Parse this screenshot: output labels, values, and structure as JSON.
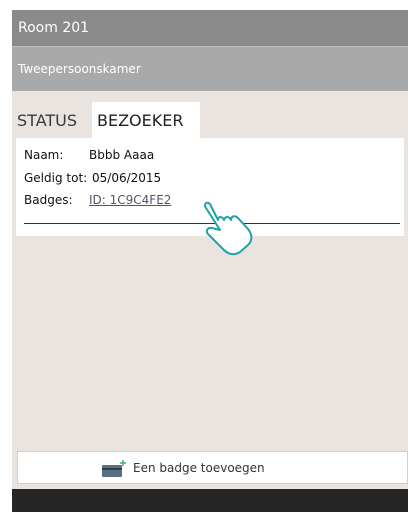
{
  "header": {
    "room_title": "Room 201",
    "room_type": "Tweepersoonskamer"
  },
  "tabs": [
    {
      "label": "STATUS",
      "active": false
    },
    {
      "label": "BEZOEKER",
      "active": true
    }
  ],
  "visitor": {
    "name_label": "Naam:",
    "name_value": "Bbbb Aaaa",
    "valid_label": "Geldig tot:",
    "valid_value": "05/06/2015",
    "badges_label": "Badges:",
    "badge_id": "ID: 1C9C4FE2"
  },
  "actions": {
    "add_badge_label": "Een badge toevoegen",
    "add_badge_icon": "card-add-icon"
  },
  "pointer": {
    "icon": "tap-hand-icon"
  },
  "colors": {
    "title_bar": "#8a8a8a",
    "subtitle_bar": "#a9a9a9",
    "panel_bg": "#e9e4df",
    "bottom_bar": "#262626",
    "hand_stroke": "#1fa3a3"
  }
}
